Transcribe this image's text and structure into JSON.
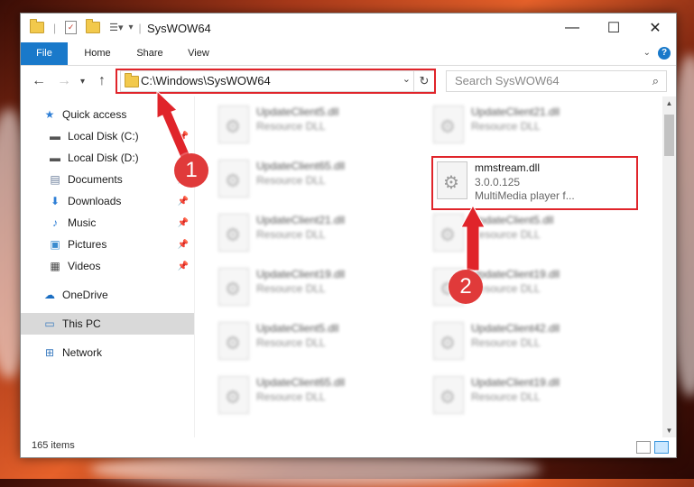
{
  "window": {
    "title": "SysWOW64",
    "controls": {
      "minimize": "—",
      "maximize": "☐",
      "close": "✕"
    }
  },
  "ribbon": {
    "tabs": [
      {
        "label": "File"
      },
      {
        "label": "Home"
      },
      {
        "label": "Share"
      },
      {
        "label": "View"
      }
    ]
  },
  "address": {
    "path": "C:\\Windows\\SysWOW64"
  },
  "search": {
    "placeholder": "Search SysWOW64"
  },
  "sidebar": {
    "items": [
      {
        "label": "Quick access",
        "icon": "star-icon"
      },
      {
        "label": "Local Disk (C:)",
        "icon": "drive-icon",
        "pinned": true
      },
      {
        "label": "Local Disk (D:)",
        "icon": "drive-icon",
        "pinned": true
      },
      {
        "label": "Documents",
        "icon": "documents-icon",
        "pinned": true
      },
      {
        "label": "Downloads",
        "icon": "download-icon",
        "pinned": true
      },
      {
        "label": "Music",
        "icon": "music-icon",
        "pinned": true
      },
      {
        "label": "Pictures",
        "icon": "pictures-icon",
        "pinned": true
      },
      {
        "label": "Videos",
        "icon": "videos-icon",
        "pinned": true
      },
      {
        "label": "OneDrive",
        "icon": "cloud-icon"
      },
      {
        "label": "This PC",
        "icon": "pc-icon",
        "selected": true
      },
      {
        "label": "Network",
        "icon": "network-icon"
      }
    ]
  },
  "files": {
    "left_column": [
      {
        "name": "UpdateClient5.dll",
        "type": "Resource DLL"
      },
      {
        "name": "UpdateClient65.dll",
        "type": "Resource DLL"
      },
      {
        "name": "UpdateClient21.dll",
        "type": "Resource DLL"
      },
      {
        "name": "UpdateClient19.dll",
        "type": "Resource DLL"
      },
      {
        "name": "UpdateClient5.dll",
        "type": "Resource DLL"
      },
      {
        "name": "UpdateClient65.dll",
        "type": "Resource DLL"
      }
    ],
    "right_column": [
      {
        "name": "UpdateClient21.dll",
        "type": "Resource DLL"
      },
      {
        "name": "UpdateClient5.dll",
        "type": "Resource DLL"
      },
      {
        "name": "UpdateClient19.dll",
        "type": "Resource DLL"
      },
      {
        "name": "UpdateClient42.dll",
        "type": "Resource DLL"
      },
      {
        "name": "UpdateClient19.dll",
        "type": "Resource DLL"
      }
    ],
    "highlighted": {
      "name": "mmstream.dll",
      "version": "3.0.0.125",
      "description": "MultiMedia player f..."
    }
  },
  "status": {
    "item_count": "165 items"
  },
  "annotations": {
    "step1": "1",
    "step2": "2",
    "color": "#e0242a"
  }
}
